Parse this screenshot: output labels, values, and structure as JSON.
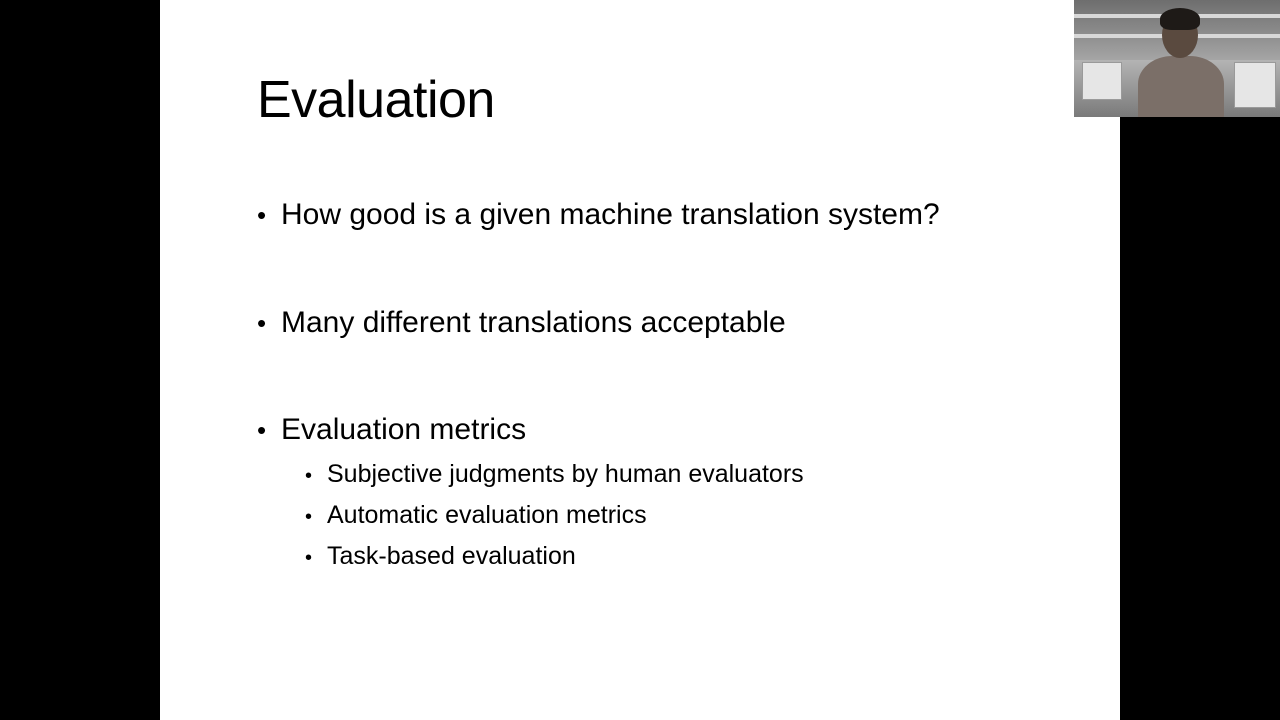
{
  "slide": {
    "title": "Evaluation",
    "bullets": [
      {
        "text": "How good is a given machine translation system?"
      },
      {
        "text": "Many different translations acceptable"
      },
      {
        "text": "Evaluation metrics"
      }
    ],
    "sub_bullets": [
      {
        "text": "Subjective judgments by human evaluators"
      },
      {
        "text": "Automatic evaluation metrics"
      },
      {
        "text": "Task-based evaluation"
      }
    ],
    "bullet_glyph": "•",
    "background_color": "#ffffff",
    "text_color": "#000000"
  },
  "frame": {
    "letterbox_color": "#000000"
  },
  "webcam": {
    "icon": "presenter-video-thumbnail"
  }
}
